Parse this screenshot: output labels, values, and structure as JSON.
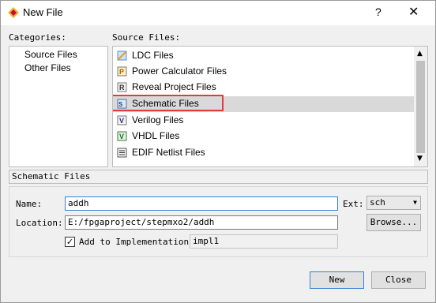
{
  "window": {
    "title": "New File",
    "help": "?",
    "close": "✕"
  },
  "categories": {
    "label": "Categories:",
    "items": [
      {
        "label": "Source Files"
      },
      {
        "label": "Other Files"
      }
    ]
  },
  "source_files": {
    "label": "Source Files:",
    "items": [
      {
        "label": "LDC Files",
        "icon": "ldc-file-icon"
      },
      {
        "label": "Power Calculator Files",
        "icon": "power-calculator-file-icon"
      },
      {
        "label": "Reveal Project Files",
        "icon": "reveal-project-file-icon"
      },
      {
        "label": "Schematic Files",
        "icon": "schematic-file-icon",
        "selected": true,
        "highlighted": true
      },
      {
        "label": "Verilog Files",
        "icon": "verilog-file-icon"
      },
      {
        "label": "VHDL Files",
        "icon": "vhdl-file-icon"
      },
      {
        "label": "EDIF Netlist Files",
        "icon": "edif-file-icon"
      }
    ]
  },
  "description": "Schematic Files",
  "form": {
    "name_label": "Name:",
    "name_value": "addh",
    "ext_label": "Ext:",
    "ext_value": "sch",
    "location_label": "Location:",
    "location_value": "E:/fpgaproject/stepmxo2/addh",
    "browse_label": "Browse...",
    "add_impl_label": "Add to Implementation",
    "add_impl_checked": true,
    "impl_value": "impl1"
  },
  "buttons": {
    "new": "New",
    "close": "Close"
  },
  "colors": {
    "highlight": "#e23b3b",
    "focus": "#3c7fd6",
    "selection": "#d9d9d9"
  }
}
